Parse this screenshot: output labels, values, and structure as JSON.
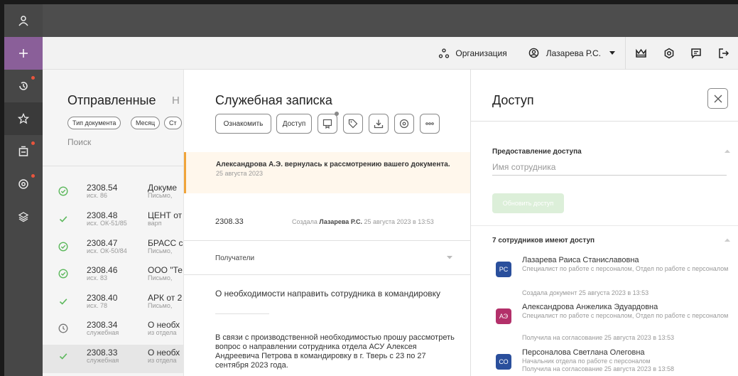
{
  "colors": {
    "accent_purple": "#8a5f99",
    "success_green": "#5cb85c",
    "notice_orange": "#f0a43a",
    "avatar_blue": "#2a4f9c",
    "avatar_magenta": "#b3306a",
    "update_button_bg": "#dcefd9"
  },
  "sidebar": {
    "icons": [
      "user-icon",
      "plus-icon",
      "history-icon",
      "star-icon",
      "inbox-icon",
      "support-icon",
      "layers-icon"
    ]
  },
  "topbar": {
    "org_label": "Организация",
    "user_name": "Лазарева Р.С."
  },
  "list": {
    "title": "Отправленные",
    "title_next": "Н",
    "chips": [
      "Тип документа",
      "Месяц",
      "Ст"
    ],
    "search_label": "Поиск",
    "rows": [
      {
        "status": "check-circle",
        "num": "2308.54",
        "sub": "исх. 86",
        "title": "Докуме",
        "title2": "Письмо, "
      },
      {
        "status": "check",
        "num": "2308.48",
        "sub": "исх. ОК-51/85",
        "title": "ЦЕНТ от",
        "title2": "варп"
      },
      {
        "status": "check-circle",
        "num": "2308.47",
        "sub": "исх. ОК-50/84",
        "title": "БРАСС с",
        "title2": "Письмо, "
      },
      {
        "status": "check-circle",
        "num": "2308.46",
        "sub": "исх. 83",
        "title": "ООО \"Те",
        "title2": "Письмо, "
      },
      {
        "status": "check",
        "num": "2308.40",
        "sub": "исх. 78",
        "title": "АРК от 2",
        "title2": "Письмо, "
      },
      {
        "status": "clock",
        "num": "2308.34",
        "sub": "служебная",
        "title": "О необх",
        "title2": "из отдела"
      },
      {
        "status": "check",
        "num": "2308.33",
        "sub": "служебная",
        "title": "О необх",
        "title2": "из отдела"
      }
    ]
  },
  "doc": {
    "title": "Служебная записка",
    "btn_familiarize": "Ознакомить",
    "btn_access": "Доступ",
    "notice_text": "Александрова А.Э. вернулась к рассмотрению вашего документа.",
    "notice_date": "25 августа 2023",
    "number": "2308.33",
    "created_prefix": "Создала",
    "created_by": "Лазарева Р.С.",
    "created_date": "25 августа 2023 в 13:53",
    "recipients_label": "Получатели",
    "subject": "О необходимости направить сотрудника в командировку",
    "body": "В связи с производственной необходимостью прошу рассмотреть вопрос о направлении сотрудника отдела АСУ Алексея Андреевича Петрова в командировку в г. Тверь с 23 по 27 сентября 2023 года."
  },
  "access": {
    "title": "Доступ",
    "grant_label": "Предоставление доступа",
    "employee_placeholder": "Имя сотрудника",
    "update_btn": "Обновить доступ",
    "users_header": "7 сотрудников имеют доступ",
    "users": [
      {
        "initials": "РС",
        "name": "Лазарева Раиса Станиславовна",
        "position": "Специалист по работе с персоналом, Отдел по работе с персоналом",
        "action": "Создала документ 25 августа 2023 в 13:53",
        "color": "#2a4f9c"
      },
      {
        "initials": "АЭ",
        "name": "Александрова Анжелика Эдуардовна",
        "position": "Специалист по работе с персоналом, Отдел по работе с персоналом",
        "action": "Получила на согласование 25 августа 2023 в 13:53",
        "color": "#b3306a"
      },
      {
        "initials": "СО",
        "name": "Персоналова Светлана Олеговна",
        "position": "Начальник отдела по работе с персоналом",
        "action": "Получила на согласование 25 августа 2023 в 13:58",
        "color": "#2a4f9c"
      }
    ]
  }
}
